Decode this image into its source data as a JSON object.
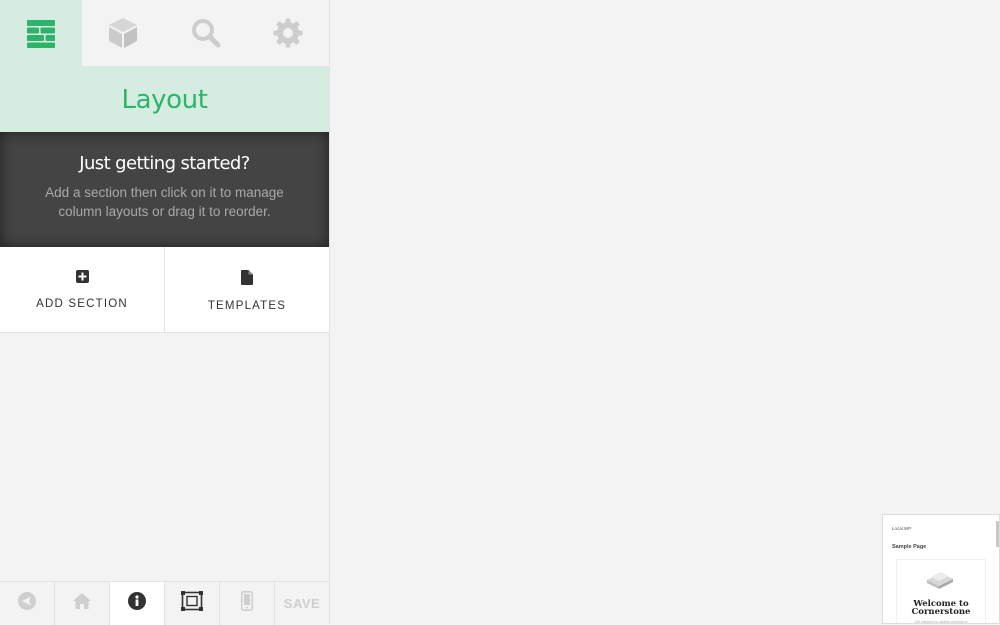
{
  "nav": {
    "tabs": [
      {
        "name": "layout",
        "icon": "layout-icon",
        "active": true
      },
      {
        "name": "elements",
        "icon": "cube-icon",
        "active": false
      },
      {
        "name": "inspector",
        "icon": "search-icon",
        "active": false
      },
      {
        "name": "settings",
        "icon": "gear-icon",
        "active": false
      }
    ]
  },
  "panel": {
    "title": "Layout"
  },
  "getting_started": {
    "title": "Just getting started?",
    "text": "Add a section then click on it to manage column layouts or drag it to reorder."
  },
  "actions": {
    "add_section_label": "ADD SECTION",
    "templates_label": "TEMPLATES"
  },
  "bottom_bar": {
    "buttons": [
      {
        "name": "exit",
        "icon": "back-arrow-icon"
      },
      {
        "name": "home",
        "icon": "home-icon"
      },
      {
        "name": "info",
        "icon": "info-icon",
        "active": true
      },
      {
        "name": "responsive",
        "icon": "fullscreen-icon"
      },
      {
        "name": "mobile",
        "icon": "mobile-icon"
      }
    ],
    "save_label": "SAVE"
  },
  "preview": {
    "site_name": "Local WP",
    "page_title": "Sample Page",
    "welcome_line1": "Welcome to",
    "welcome_line2": "Cornerstone",
    "subtext": "Get inspired for adding sections to"
  },
  "colors": {
    "accent": "#2fb36a",
    "accent_bg": "#d5ede0",
    "dark_box": "#444444",
    "canvas_bg": "#f3f3f3"
  }
}
